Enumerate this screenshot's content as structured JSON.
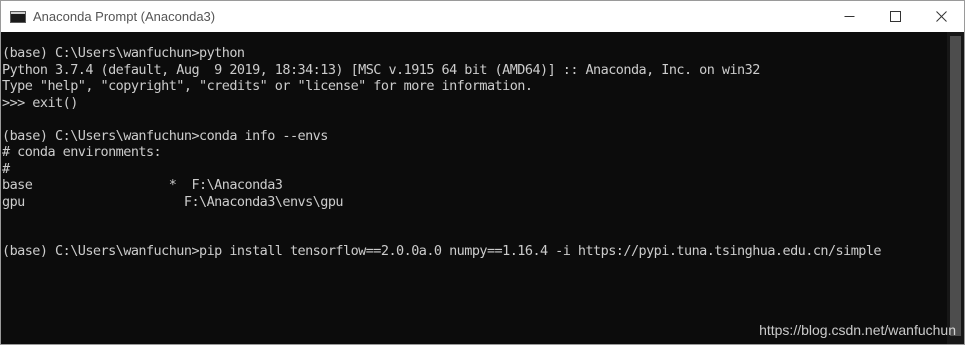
{
  "window": {
    "title": "Anaconda Prompt (Anaconda3)"
  },
  "icons": {
    "app": "console-icon",
    "minimize": "minimize-icon",
    "maximize": "maximize-icon",
    "close": "close-icon"
  },
  "terminal": {
    "lines": [
      "",
      "(base) C:\\Users\\wanfuchun>python",
      "Python 3.7.4 (default, Aug  9 2019, 18:34:13) [MSC v.1915 64 bit (AMD64)] :: Anaconda, Inc. on win32",
      "Type \"help\", \"copyright\", \"credits\" or \"license\" for more information.",
      ">>> exit()",
      "",
      "(base) C:\\Users\\wanfuchun>conda info --envs",
      "# conda environments:",
      "#",
      "base                  *  F:\\Anaconda3",
      "gpu                     F:\\Anaconda3\\envs\\gpu",
      "",
      "",
      "(base) C:\\Users\\wanfuchun>pip install tensorflow==2.0.0a.0 numpy==1.16.4 -i https://pypi.tuna.tsinghua.edu.cn/simple"
    ]
  },
  "watermark": "https://blog.csdn.net/wanfuchun",
  "colors": {
    "terminal_bg": "#0c0c0c",
    "terminal_fg": "#cccccc",
    "titlebar_bg": "#ffffff"
  }
}
